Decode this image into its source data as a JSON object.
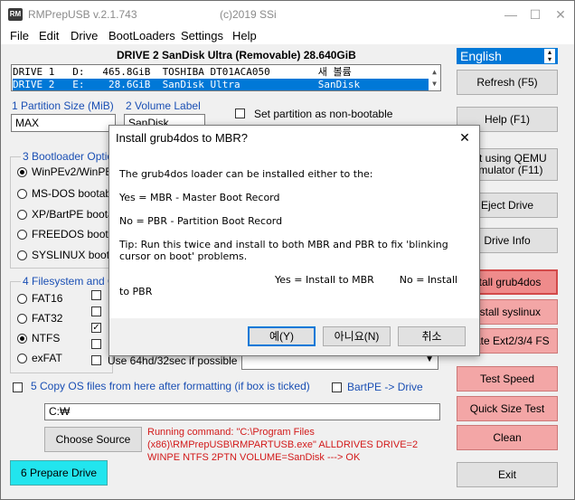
{
  "app": {
    "title": "RMPrepUSB v.2.1.743",
    "copyright": "(c)2019 SSi",
    "icon_text": "RM"
  },
  "window_buttons": {
    "minimize": "—",
    "maximize": "☐",
    "close": "✕"
  },
  "menu": [
    "File",
    "Edit",
    "Drive",
    "BootLoaders",
    "Settings",
    "Help"
  ],
  "drive_header": "DRIVE 2 SanDisk Ultra  (Removable) 28.640GiB",
  "drives": [
    {
      "text": "DRIVE 1   D:   465.8GiB  TOSHIBA DT01ACA050        새 볼륨",
      "selected": false
    },
    {
      "text": "DRIVE 2   E:    28.6GiB  SanDisk Ultra             SanDisk",
      "selected": true
    }
  ],
  "language": {
    "value": "English"
  },
  "partition": {
    "size_label": "1 Partition Size (MiB)",
    "size_value": "MAX",
    "volume_label": "2 Volume Label",
    "volume_value": "SanDisk",
    "nonbootable_label": "Set partition as non-bootable"
  },
  "bootloader": {
    "group_label": "3 Bootloader Option",
    "options": [
      "WinPEv2/WinPE",
      "MS-DOS bootable",
      "XP/BartPE bootab",
      "FREEDOS bootab",
      "SYSLINUX bootab"
    ]
  },
  "filesystem": {
    "group_label": "4 Filesystem and Ov",
    "options": [
      "FAT16",
      "FAT32",
      "NTFS",
      "exFAT"
    ],
    "use64_label": "Use 64hd/32sec if possible"
  },
  "copy_os": {
    "label": "5 Copy OS files from here after formatting (if box is ticked)",
    "bartpe_label": "BartPE -> Drive",
    "path_value": "C:₩"
  },
  "buttons": {
    "refresh": "Refresh (F5)",
    "help": "Help (F1)",
    "test_qemu_1": "est using QEMU",
    "test_qemu_2": "Emulator (F11)",
    "eject": "Eject Drive",
    "drive_info": "Drive Info",
    "install_grub4dos": "stall grub4dos",
    "install_syslinux": "nstall syslinux",
    "create_ext": "reate Ext2/3/4 FS",
    "test_speed": "Test Speed",
    "quick_size": "Quick Size Test",
    "clean": "Clean",
    "exit": "Exit",
    "choose_source": "Choose Source",
    "prepare_drive": "6 Prepare Drive"
  },
  "status": {
    "text": "Running command: \"C:\\Program Files (x86)\\RMPrepUSB\\RMPARTUSB.exe\"  ALLDRIVES DRIVE=2 WINPE NTFS 2PTN VOLUME=SanDisk ---> OK"
  },
  "dialog": {
    "title": "Install grub4dos to MBR?",
    "line1": "The grub4dos loader can be installed either to the:",
    "line2": "Yes = MBR - Master Boot Record",
    "line3": "No = PBR - Partition Boot Record",
    "line4": "Tip: Run this twice and install to both MBR and PBR to fix 'blinking",
    "line5": "cursor on boot' problems.",
    "line6": "Yes = Install to MBR        No = Install",
    "line7": "to PBR",
    "yes": "예(Y)",
    "no": "아니요(N)",
    "cancel": "취소",
    "close": "✕"
  }
}
